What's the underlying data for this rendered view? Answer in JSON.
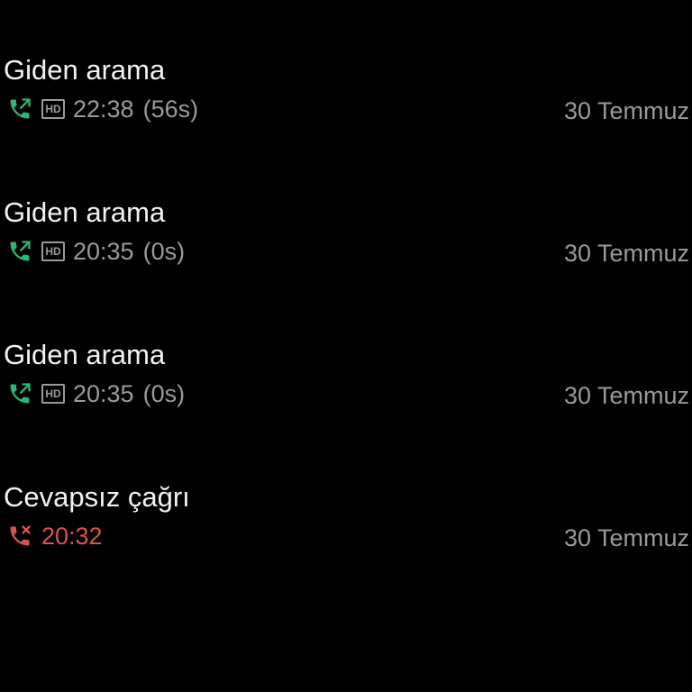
{
  "calls": [
    {
      "title": "Giden arama",
      "type_icon": "outgoing-call-icon",
      "hd": "HD",
      "time": "22:38",
      "duration": "(56s)",
      "date": "30 Temmuz"
    },
    {
      "title": "Giden arama",
      "type_icon": "outgoing-call-icon",
      "hd": "HD",
      "time": "20:35",
      "duration": "(0s)",
      "date": "30 Temmuz"
    },
    {
      "title": "Giden arama",
      "type_icon": "outgoing-call-icon",
      "hd": "HD",
      "time": "20:35",
      "duration": "(0s)",
      "date": "30 Temmuz"
    },
    {
      "title": "Cevapsız çağrı",
      "type_icon": "missed-call-icon",
      "time": "20:32",
      "date": "30 Temmuz"
    }
  ],
  "colors": {
    "background": "#000000",
    "title": "#f2f2f2",
    "secondary": "#9a9a9a",
    "outgoing": "#2bb673",
    "missed": "#d9534f"
  }
}
